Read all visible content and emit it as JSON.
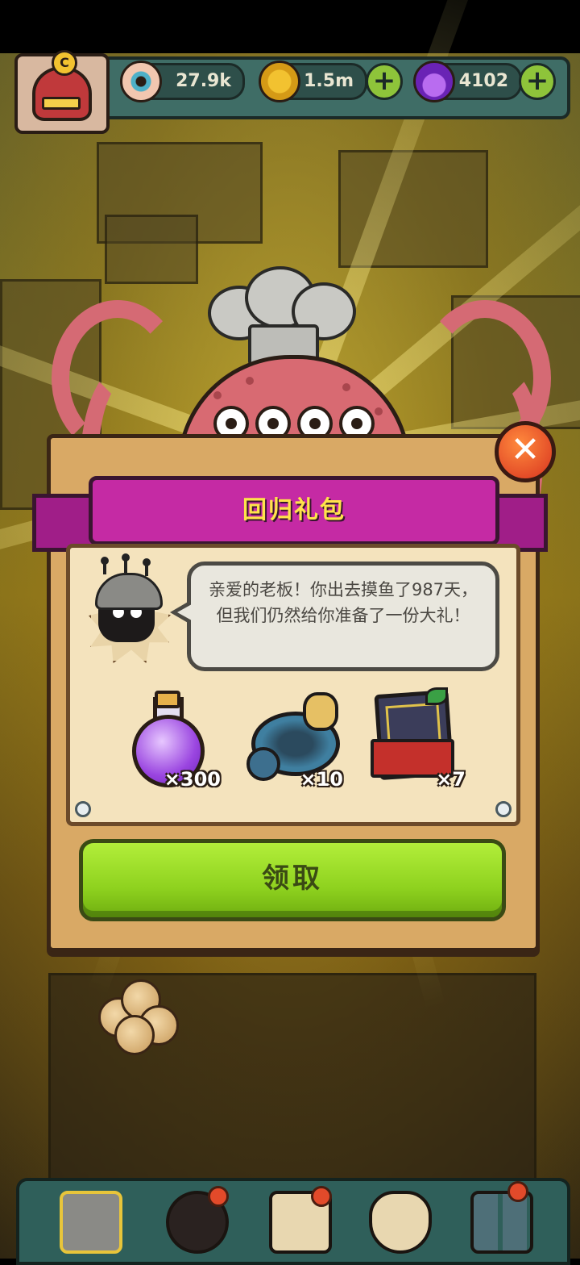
{
  "resources": {
    "eyes": {
      "value": "27.9k",
      "icon": "eyeball-icon"
    },
    "coins": {
      "value": "1.5m",
      "icon": "coin-icon"
    },
    "potions": {
      "value": "4102",
      "icon": "potion-icon"
    }
  },
  "avatar": {
    "badge": "C"
  },
  "dialog": {
    "title": "回归礼包",
    "message": "亲爱的老板！你出去摸鱼了987天，但我们仍然给你准备了一份大礼！",
    "close_icon": "close-icon",
    "rewards": [
      {
        "name": "potion-reward",
        "icon": "purple-potion-icon",
        "qty": "×300"
      },
      {
        "name": "trap-reward",
        "icon": "trap-icon",
        "qty": "×10"
      },
      {
        "name": "card-pack-reward",
        "icon": "card-pack-icon",
        "qty": "×7"
      }
    ],
    "claim_label": "领取"
  },
  "bottom_nav": [
    {
      "name": "nav-restaurant",
      "icon": "restaurant-icon"
    },
    {
      "name": "nav-monsters",
      "icon": "monster-icon"
    },
    {
      "name": "nav-book",
      "icon": "book-icon"
    },
    {
      "name": "nav-bag",
      "icon": "money-bag-icon"
    },
    {
      "name": "nav-more",
      "icon": "grid-icon"
    }
  ],
  "colors": {
    "ribbon": "#c52aa4",
    "title_text": "#ffe34a",
    "claim_button": "#8fd21f",
    "close_button": "#d8331f",
    "top_bar": "#3f6d66"
  }
}
